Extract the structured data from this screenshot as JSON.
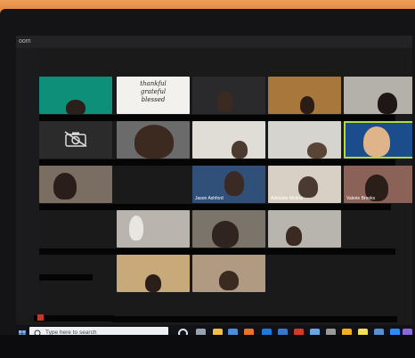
{
  "window": {
    "title_fragment": "oom"
  },
  "tiles": [
    {
      "id": "t1",
      "name": "",
      "bg": "#0e8f7a"
    },
    {
      "id": "t2",
      "name": "",
      "bg": "#f2f1ee",
      "sign": [
        "thankful",
        "grateful",
        "blessed"
      ]
    },
    {
      "id": "t3",
      "name": "",
      "bg": "#2a2a2c"
    },
    {
      "id": "t4",
      "name": "",
      "bg": "#a8773c"
    },
    {
      "id": "t5",
      "name": "",
      "bg": "#b4b0aa"
    },
    {
      "id": "t6",
      "name": "",
      "bg": "#2b2b2b",
      "camera_off": true
    },
    {
      "id": "t7",
      "name": "",
      "bg": "#6b6b6b"
    },
    {
      "id": "t8",
      "name": "",
      "bg": "#e0ddd6"
    },
    {
      "id": "t9",
      "name": "",
      "bg": "#d6d4cf"
    },
    {
      "id": "t10",
      "name": "",
      "bg": "#1b4c8c",
      "active_speaker": true
    },
    {
      "id": "t11",
      "name": "",
      "bg": "#7a6e63"
    },
    {
      "id": "t12",
      "name": "",
      "bg": "#1a1a1a"
    },
    {
      "id": "t13",
      "name": "Jason Ashford",
      "bg": "#30507a"
    },
    {
      "id": "t14",
      "name": "Adelaide Molina",
      "bg": "#d8d0c4"
    },
    {
      "id": "t15",
      "name": "Valerie Brooks",
      "bg": "#8b6258"
    },
    {
      "id": "t16",
      "name": "",
      "bg": "#1a1a1a"
    },
    {
      "id": "t17",
      "name": "",
      "bg": "#b9b5ae"
    },
    {
      "id": "t18",
      "name": "",
      "bg": "#7b746b"
    },
    {
      "id": "t19",
      "name": "",
      "bg": "#b8b4ae"
    },
    {
      "id": "t20",
      "name": "",
      "bg": "#1a1a1a"
    },
    {
      "id": "t21",
      "name": "",
      "bg": "#1a1a1a"
    },
    {
      "id": "t22",
      "name": "",
      "bg": "#c8a979"
    },
    {
      "id": "t23",
      "name": "",
      "bg": "#b09a82"
    },
    {
      "id": "t24",
      "name": "",
      "bg": "#1a1a1a"
    },
    {
      "id": "t25",
      "name": "",
      "bg": "#1a1a1a"
    }
  ],
  "taskbar": {
    "search_placeholder": "Type here to search",
    "icons": [
      "start-icon",
      "cortana-icon",
      "task-view-icon",
      "file-explorer-icon",
      "store-icon",
      "firefox-icon",
      "edge-icon",
      "ie-icon",
      "acrobat-icon",
      "pc-icon",
      "misc-icon",
      "chrome-icon",
      "sticky-notes-icon",
      "app-icon",
      "zoom-icon",
      "app2-icon"
    ]
  }
}
